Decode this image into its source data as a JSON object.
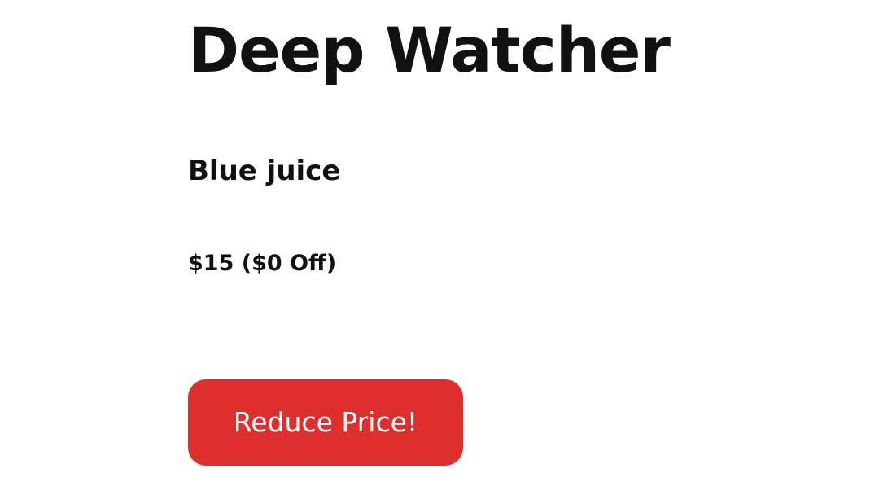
{
  "product": {
    "name": "Deep Watcher",
    "variant": "Blue juice",
    "price_line": "$15 ($0 Off)"
  },
  "actions": {
    "reduce_price_label": "Reduce Price!"
  },
  "colors": {
    "button_background": "#de2f2f",
    "button_text": "#ffffff",
    "text": "#111111",
    "background": "#ffffff"
  }
}
